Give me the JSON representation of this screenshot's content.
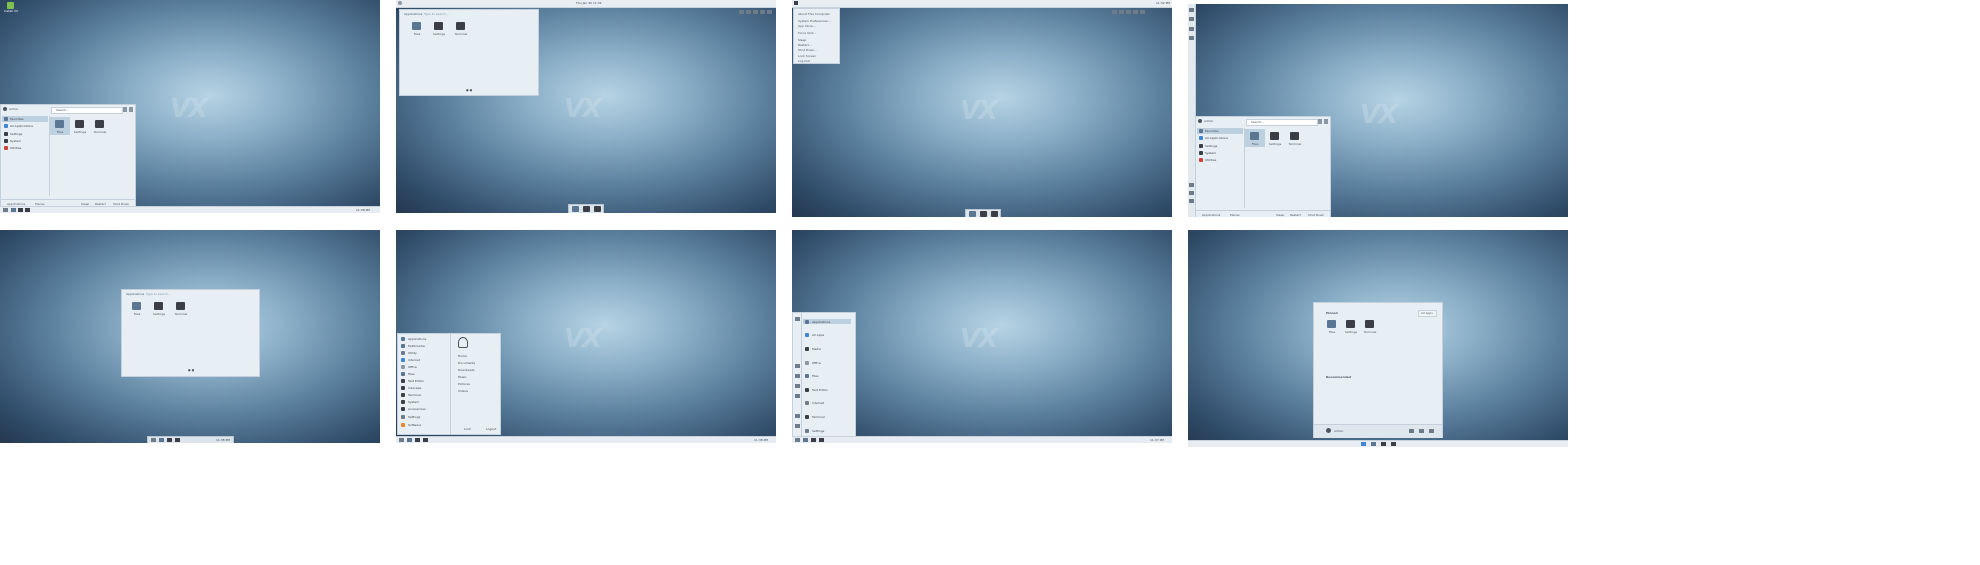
{
  "desktop_logo": "VX",
  "panel1": {
    "desktop_icon_label": "Install VX",
    "search_placeholder": "Search...",
    "user": "admin",
    "sidebar": [
      "Favorites",
      "All Applications",
      "Settings",
      "System",
      "Utilities"
    ],
    "tiles": [
      "Files",
      "Settings",
      "Terminal"
    ],
    "footer": [
      "Applications",
      "Places",
      "Sleep",
      "Restart",
      "Shut Down"
    ],
    "clock": "11:38 PM"
  },
  "panel2": {
    "topbar_clock": "Thu Jan 30 11:32",
    "tabs": [
      "Applications",
      "Type to search..."
    ],
    "tiles": [
      "Files",
      "Settings",
      "Terminal"
    ]
  },
  "panel3": {
    "menu_items": [
      "About This Computer",
      "System Preferences...",
      "App Store...",
      "Force Quit...",
      "Sleep",
      "Restart...",
      "Shut Down...",
      "Lock Screen",
      "Log Out"
    ],
    "clock": "11:32 PM"
  },
  "panel4": {
    "search_placeholder": "Search...",
    "user": "admin",
    "sidebar": [
      "Favorites",
      "All Applications",
      "Settings",
      "System",
      "Utilities"
    ],
    "tiles": [
      "Files",
      "Settings",
      "Terminal"
    ],
    "footer": [
      "Applications",
      "Places",
      "Sleep",
      "Restart",
      "Shut Down"
    ]
  },
  "panel5": {
    "tabs": [
      "Applications",
      "Type to search..."
    ],
    "tiles": [
      "Files",
      "Settings",
      "Terminal"
    ],
    "clock": "11:38 PM"
  },
  "panel6": {
    "categories": [
      "Applications",
      "Multimedia",
      "Utility",
      "Internet",
      "Office",
      "Files",
      "Text Editor",
      "Inkscape",
      "Terminal",
      "System",
      "Accessories",
      "Settings",
      "Software"
    ],
    "places": [
      "Home",
      "Documents",
      "Downloads",
      "Music",
      "Pictures",
      "Videos"
    ],
    "footer": [
      "Lock",
      "Logout"
    ],
    "clock": "11:38 PM"
  },
  "panel7": {
    "entries": [
      "Applications",
      "All Apps",
      "Media",
      "Office",
      "Files",
      "Text Editor",
      "Internet",
      "Terminal",
      "Settings"
    ],
    "clock": "11:37 PM"
  },
  "panel8": {
    "title": "Pinned",
    "tiles": [
      "Files",
      "Settings",
      "Terminal"
    ],
    "all_apps": "All apps",
    "recommended": "Recommended",
    "user": "admin"
  }
}
